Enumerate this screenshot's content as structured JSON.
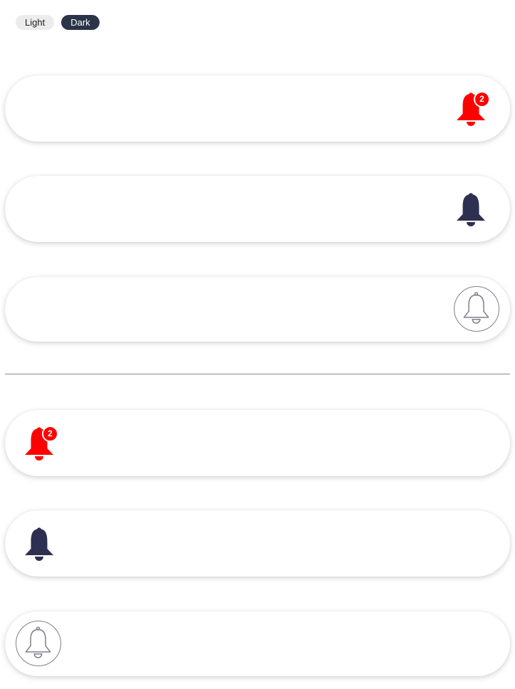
{
  "theme_toggle": {
    "light_label": "Light",
    "dark_label": "Dark",
    "selected": "Dark"
  },
  "colors": {
    "alert_red": "#ff0000",
    "bell_dark": "#2d3050",
    "outline_gray": "#80818c",
    "dark_pill": "#2b3448"
  },
  "right_aligned_bars": [
    {
      "variant": "filled-with-badge",
      "icon": "bell-icon",
      "badge_count": "2"
    },
    {
      "variant": "filled",
      "icon": "bell-icon"
    },
    {
      "variant": "outline",
      "icon": "bell-outline-icon"
    }
  ],
  "left_aligned_bars": [
    {
      "variant": "filled-with-badge",
      "icon": "bell-icon",
      "badge_count": "2"
    },
    {
      "variant": "filled",
      "icon": "bell-icon"
    },
    {
      "variant": "outline",
      "icon": "bell-outline-icon"
    }
  ]
}
